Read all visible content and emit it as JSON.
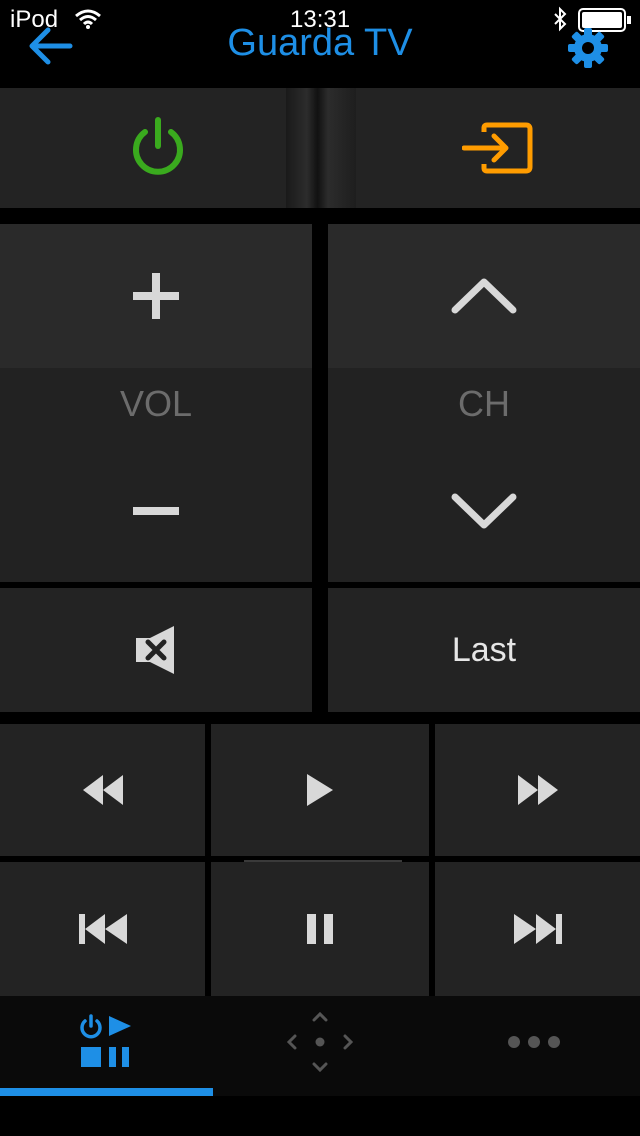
{
  "status_bar": {
    "carrier": "iPod",
    "time": "13:31"
  },
  "nav": {
    "title": "Guarda TV"
  },
  "remote": {
    "vol_label": "VOL",
    "ch_label": "CH",
    "last_label": "Last"
  },
  "colors": {
    "accent": "#1e8fe6",
    "power": "#3aaa1e",
    "input": "#ff9c00"
  },
  "tabs": [
    {
      "icon": "power-play-stop-pause-icon",
      "selected": true
    },
    {
      "icon": "dpad-icon",
      "selected": false
    },
    {
      "icon": "more-dots-icon",
      "selected": false
    }
  ]
}
